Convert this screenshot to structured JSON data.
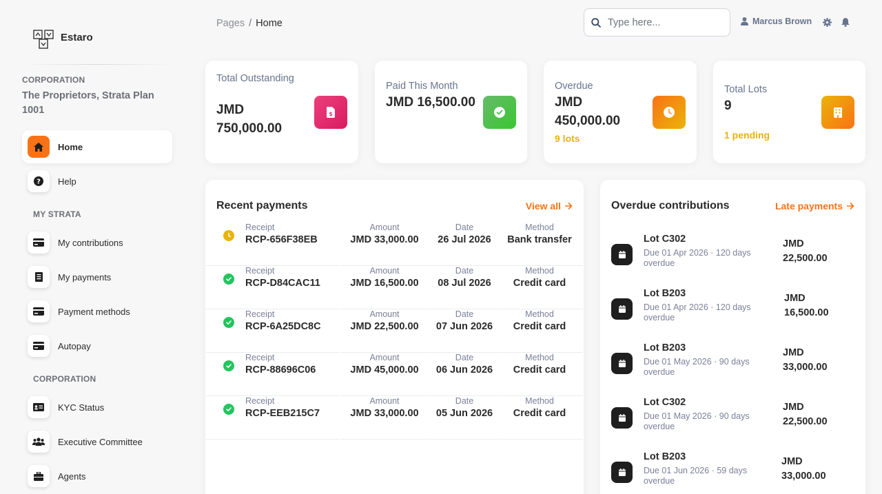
{
  "brand": {
    "name": "Estaro"
  },
  "sidebar": {
    "corp_label": "CORPORATION",
    "corp_name": "The Proprietors, Strata Plan 1001",
    "home": "Home",
    "help": "Help",
    "my_strata_label": "MY STRATA",
    "my_strata": [
      "My contributions",
      "My payments",
      "Payment methods",
      "Autopay"
    ],
    "corporation_label": "CORPORATION",
    "corporation": [
      "KYC Status",
      "Executive Committee",
      "Agents"
    ]
  },
  "header": {
    "breadcrumb_root": "Pages",
    "breadcrumb_sep": "/",
    "breadcrumb_current": "Home",
    "search_placeholder": "Type here...",
    "user_name": "Marcus Brown"
  },
  "stats": [
    {
      "title": "Total Outstanding",
      "value": "JMD 750,000.00",
      "sub": "",
      "icon": "invoice-dollar-icon",
      "color": "#ec407a"
    },
    {
      "title": "Paid This Month",
      "value": "JMD 16,500.00",
      "sub": "",
      "icon": "check-circle-icon",
      "color": "#66bb6a"
    },
    {
      "title": "Overdue",
      "value": "JMD 450,000.00",
      "sub": "9 lots",
      "icon": "clock-icon",
      "color": "#f97316"
    },
    {
      "title": "Total Lots",
      "value": "9",
      "sub": "1 pending",
      "icon": "building-icon",
      "color": "#f97316"
    }
  ],
  "recent": {
    "title": "Recent payments",
    "link": "View all",
    "labels": {
      "receipt": "Receipt",
      "amount": "Amount",
      "date": "Date",
      "method": "Method"
    },
    "rows": [
      {
        "status": "pending",
        "receipt": "RCP-656F38EB",
        "amount": "JMD 33,000.00",
        "date": "26 Jul 2026",
        "method": "Bank transfer"
      },
      {
        "status": "paid",
        "receipt": "RCP-D84CAC11",
        "amount": "JMD 16,500.00",
        "date": "08 Jul 2026",
        "method": "Credit card"
      },
      {
        "status": "paid",
        "receipt": "RCP-6A25DC8C",
        "amount": "JMD 22,500.00",
        "date": "07 Jun 2026",
        "method": "Credit card"
      },
      {
        "status": "paid",
        "receipt": "RCP-88696C06",
        "amount": "JMD 45,000.00",
        "date": "06 Jun 2026",
        "method": "Credit card"
      },
      {
        "status": "paid",
        "receipt": "RCP-EEB215C7",
        "amount": "JMD 33,000.00",
        "date": "05 Jun 2026",
        "method": "Credit card"
      }
    ]
  },
  "overdue": {
    "title": "Overdue contributions",
    "link": "Late payments",
    "rows": [
      {
        "lot": "Lot C302",
        "due": "Due 01 Apr 2026 · 120 days overdue",
        "amount": "JMD 22,500.00"
      },
      {
        "lot": "Lot B203",
        "due": "Due 01 Apr 2026 · 120 days overdue",
        "amount": "JMD 16,500.00"
      },
      {
        "lot": "Lot B203",
        "due": "Due 01 May 2026 · 90 days overdue",
        "amount": "JMD 33,000.00"
      },
      {
        "lot": "Lot C302",
        "due": "Due 01 May 2026 · 90 days overdue",
        "amount": "JMD 22,500.00"
      },
      {
        "lot": "Lot B203",
        "due": "Due 01 Jun 2026 · 59 days overdue",
        "amount": "JMD 33,000.00"
      }
    ]
  },
  "colors": {
    "accent": "#f97316",
    "warning": "#eab308",
    "success": "#22c55e"
  }
}
